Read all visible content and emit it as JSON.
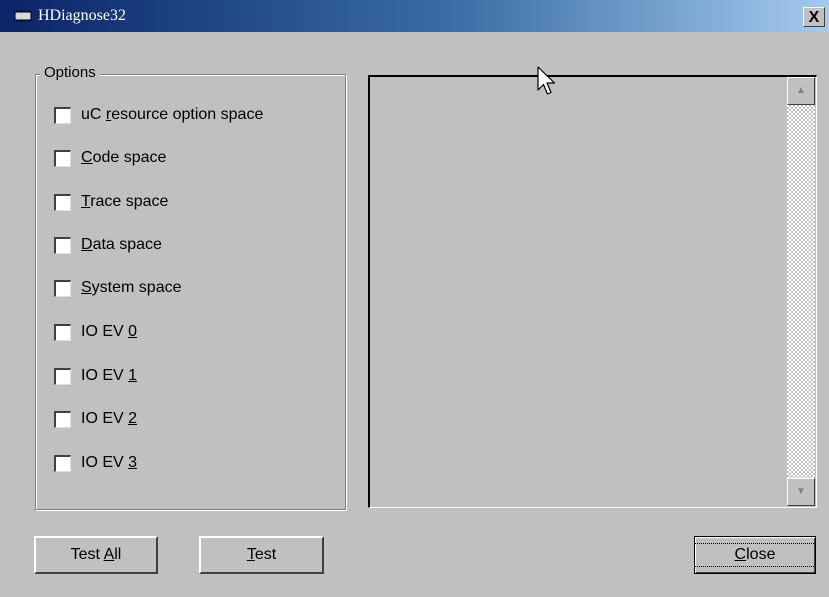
{
  "window": {
    "title": "HDiagnose32",
    "title_icon": "app-icon",
    "close_glyph": "X"
  },
  "options": {
    "legend": "Options",
    "items": [
      {
        "pre": "uC ",
        "acc": "r",
        "post": "esource option space",
        "checked": false
      },
      {
        "pre": "",
        "acc": "C",
        "post": "ode space",
        "checked": false
      },
      {
        "pre": "",
        "acc": "T",
        "post": "race space",
        "checked": false
      },
      {
        "pre": "",
        "acc": "D",
        "post": "ata space",
        "checked": false
      },
      {
        "pre": "",
        "acc": "S",
        "post": "ystem space",
        "checked": false
      },
      {
        "pre": "IO EV ",
        "acc": "0",
        "post": "",
        "checked": false
      },
      {
        "pre": "IO EV ",
        "acc": "1",
        "post": "",
        "checked": false
      },
      {
        "pre": "IO EV ",
        "acc": "2",
        "post": "",
        "checked": false
      },
      {
        "pre": "IO EV ",
        "acc": "3",
        "post": "",
        "checked": false
      }
    ]
  },
  "buttons": {
    "test_all": {
      "pre": "Test ",
      "acc": "A",
      "post": "ll"
    },
    "test": {
      "pre": "",
      "acc": "T",
      "post": "est"
    },
    "close": {
      "pre": "",
      "acc": "C",
      "post": "lose"
    }
  },
  "scrollbar": {
    "up_glyph": "▲",
    "down_glyph": "▼"
  }
}
